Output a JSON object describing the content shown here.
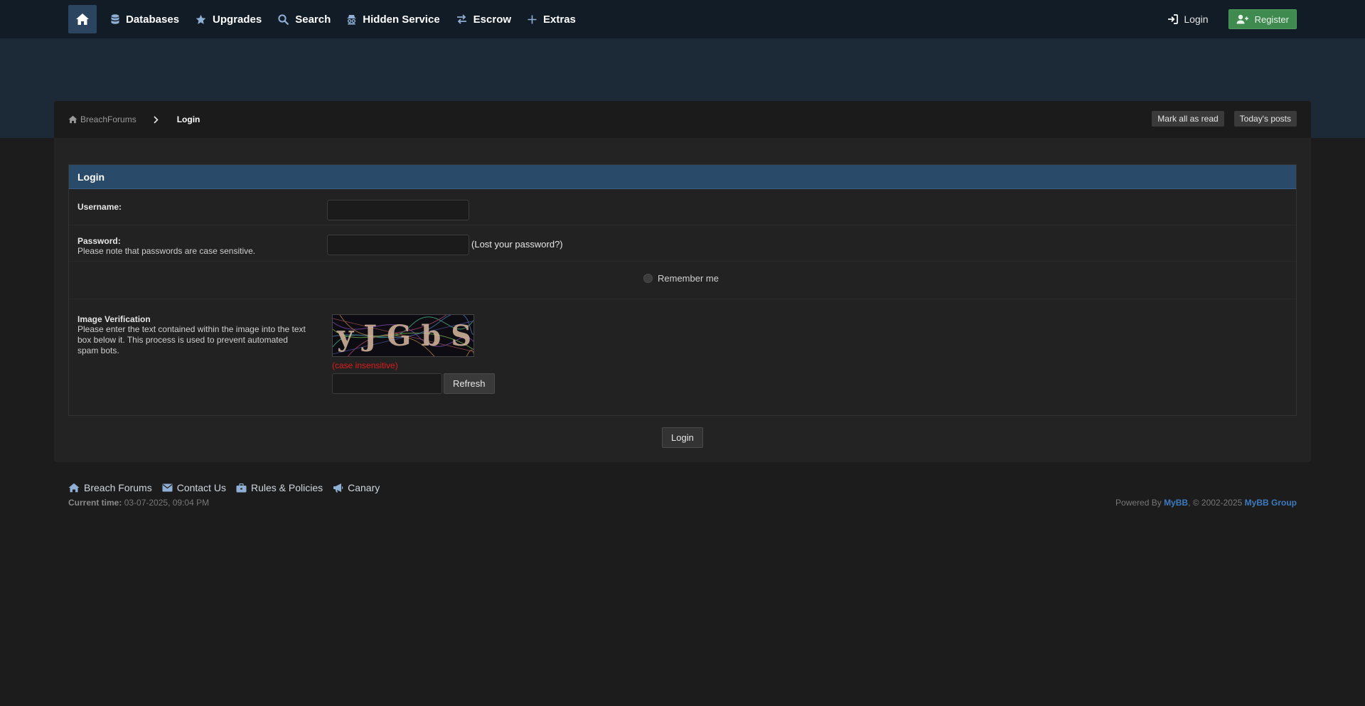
{
  "nav": {
    "items": [
      {
        "label": "Databases",
        "icon": "database-icon"
      },
      {
        "label": "Upgrades",
        "icon": "star-icon"
      },
      {
        "label": "Search",
        "icon": "search-icon"
      },
      {
        "label": "Hidden Service",
        "icon": "incognito-icon"
      },
      {
        "label": "Escrow",
        "icon": "exchange-icon"
      },
      {
        "label": "Extras",
        "icon": "plus-icon"
      }
    ],
    "login_label": "Login",
    "register_label": "Register"
  },
  "breadcrumb": {
    "home_label": "BreachForums",
    "current": "Login",
    "actions": [
      "Mark all as read",
      "Today's posts"
    ]
  },
  "form": {
    "title": "Login",
    "username_label": "Username:",
    "password_label": "Password:",
    "password_note": "Please note that passwords are case sensitive.",
    "lost_password_prefix": "(",
    "lost_password_link": "Lost your password?",
    "lost_password_suffix": ")",
    "remember_label": "Remember me",
    "captcha_title": "Image Verification",
    "captcha_note": "Please enter the text contained within the image into the text box below it. This process is used to prevent automated spam bots.",
    "captcha_text": "yJGbS",
    "case_note": "(case insensitive)",
    "refresh_label": "Refresh",
    "submit_label": "Login"
  },
  "footer": {
    "links": [
      {
        "label": "Breach Forums",
        "icon": "home-icon"
      },
      {
        "label": "Contact Us",
        "icon": "envelope-icon"
      },
      {
        "label": "Rules & Policies",
        "icon": "briefcase-icon"
      },
      {
        "label": "Canary",
        "icon": "bullhorn-icon"
      }
    ],
    "current_time_label": "Current time:",
    "current_time_value": "03-07-2025, 09:04 PM",
    "powered_prefix": "Powered By ",
    "powered_brand": "MyBB",
    "powered_middle": ", © 2002-2025 ",
    "powered_group": "MyBB Group"
  },
  "colors": {
    "accent": "#2a4a6a",
    "register": "#3f8a4f",
    "link": "#3c7bc0",
    "warning": "#e01b1b"
  }
}
